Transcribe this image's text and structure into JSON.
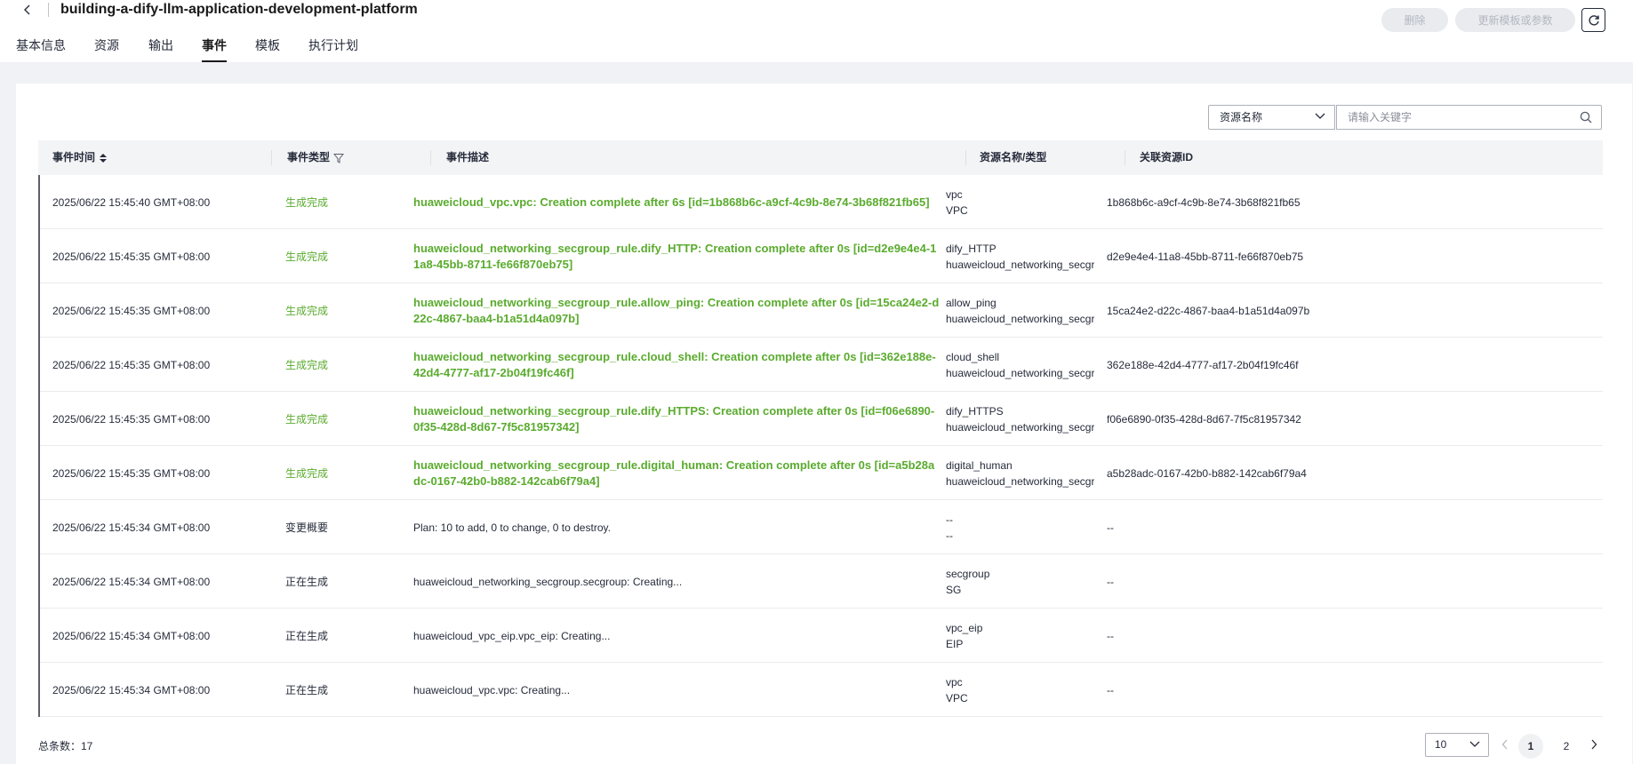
{
  "header": {
    "title": "building-a-dify-llm-application-development-platform",
    "delete_label": "删除",
    "update_label": "更新模板或参数"
  },
  "tabs": [
    {
      "label": "基本信息"
    },
    {
      "label": "资源"
    },
    {
      "label": "输出"
    },
    {
      "label": "事件",
      "active": true
    },
    {
      "label": "模板"
    },
    {
      "label": "执行计划"
    }
  ],
  "filter": {
    "select_value": "资源名称",
    "search_placeholder": "请输入关键字"
  },
  "table": {
    "columns": [
      "事件时间",
      "事件类型",
      "事件描述",
      "资源名称/类型",
      "关联资源ID"
    ],
    "rows": [
      {
        "time": "2025/06/22 15:45:40 GMT+08:00",
        "type": "生成完成",
        "status": "done",
        "desc": "huaweicloud_vpc.vpc: Creation complete after 6s [id=1b868b6c-a9cf-4c9b-8e74-3b68f821fb65]",
        "res_name": "vpc",
        "res_type": "VPC",
        "res_id": "1b868b6c-a9cf-4c9b-8e74-3b68f821fb65"
      },
      {
        "time": "2025/06/22 15:45:35 GMT+08:00",
        "type": "生成完成",
        "status": "done",
        "desc": "huaweicloud_networking_secgroup_rule.dify_HTTP: Creation complete after 0s [id=d2e9e4e4-11a8-45bb-8711-fe66f870eb75]",
        "res_name": "dify_HTTP",
        "res_type": "huaweicloud_networking_secgroup_",
        "res_id": "d2e9e4e4-11a8-45bb-8711-fe66f870eb75"
      },
      {
        "time": "2025/06/22 15:45:35 GMT+08:00",
        "type": "生成完成",
        "status": "done",
        "desc": "huaweicloud_networking_secgroup_rule.allow_ping: Creation complete after 0s [id=15ca24e2-d22c-4867-baa4-b1a51d4a097b]",
        "res_name": "allow_ping",
        "res_type": "huaweicloud_networking_secgroup_",
        "res_id": "15ca24e2-d22c-4867-baa4-b1a51d4a097b"
      },
      {
        "time": "2025/06/22 15:45:35 GMT+08:00",
        "type": "生成完成",
        "status": "done",
        "desc": "huaweicloud_networking_secgroup_rule.cloud_shell: Creation complete after 0s [id=362e188e-42d4-4777-af17-2b04f19fc46f]",
        "res_name": "cloud_shell",
        "res_type": "huaweicloud_networking_secgroup_",
        "res_id": "362e188e-42d4-4777-af17-2b04f19fc46f"
      },
      {
        "time": "2025/06/22 15:45:35 GMT+08:00",
        "type": "生成完成",
        "status": "done",
        "desc": "huaweicloud_networking_secgroup_rule.dify_HTTPS: Creation complete after 0s [id=f06e6890-0f35-428d-8d67-7f5c81957342]",
        "res_name": "dify_HTTPS",
        "res_type": "huaweicloud_networking_secgroup_",
        "res_id": "f06e6890-0f35-428d-8d67-7f5c81957342"
      },
      {
        "time": "2025/06/22 15:45:35 GMT+08:00",
        "type": "生成完成",
        "status": "done",
        "desc": "huaweicloud_networking_secgroup_rule.digital_human: Creation complete after 0s [id=a5b28adc-0167-42b0-b882-142cab6f79a4]",
        "res_name": "digital_human",
        "res_type": "huaweicloud_networking_secgroup_",
        "res_id": "a5b28adc-0167-42b0-b882-142cab6f79a4"
      },
      {
        "time": "2025/06/22 15:45:34 GMT+08:00",
        "type": "变更概要",
        "status": "normal",
        "desc": "Plan: 10 to add, 0 to change, 0 to destroy.",
        "res_name": "--",
        "res_type": "--",
        "res_id": "--"
      },
      {
        "time": "2025/06/22 15:45:34 GMT+08:00",
        "type": "正在生成",
        "status": "normal",
        "desc": "huaweicloud_networking_secgroup.secgroup: Creating...",
        "res_name": "secgroup",
        "res_type": "SG",
        "res_id": "--"
      },
      {
        "time": "2025/06/22 15:45:34 GMT+08:00",
        "type": "正在生成",
        "status": "normal",
        "desc": "huaweicloud_vpc_eip.vpc_eip: Creating...",
        "res_name": "vpc_eip",
        "res_type": "EIP",
        "res_id": "--"
      },
      {
        "time": "2025/06/22 15:45:34 GMT+08:00",
        "type": "正在生成",
        "status": "normal",
        "desc": "huaweicloud_vpc.vpc: Creating...",
        "res_name": "vpc",
        "res_type": "VPC",
        "res_id": "--"
      }
    ]
  },
  "pagination": {
    "total_label": "总条数：17",
    "page_size": "10",
    "pages": [
      "1",
      "2"
    ],
    "current_page": "1"
  },
  "colors": {
    "success_text": "#5aab2e",
    "primary_text": "#252b3a",
    "page_background": "#f0f2f5"
  },
  "icons": [
    "back-arrow-icon",
    "refresh-icon",
    "sort-icon",
    "filter-icon",
    "chevron-down-icon",
    "search-icon",
    "chevron-left-icon",
    "chevron-right-icon"
  ]
}
